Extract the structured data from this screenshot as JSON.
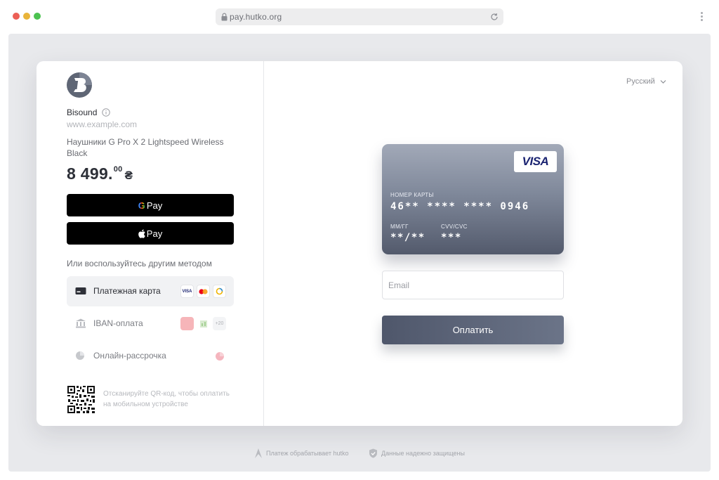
{
  "browser": {
    "url": "pay.hutko.org"
  },
  "merchant": {
    "name": "Bisound",
    "site": "www.example.com",
    "product": "Наушники G Pro X 2 Lightspeed Wireless Black",
    "price_main": "8 499.",
    "price_cents": "00",
    "currency": "₴"
  },
  "wallets": {
    "gpay_g": "G",
    "gpay_label": "Pay",
    "apay_label": "Pay"
  },
  "alt_methods_title": "Или воспользуйтесь другим методом",
  "methods": [
    {
      "label": "Платежная карта",
      "active": true,
      "badges": [
        "VISA",
        "mastercard",
        "card-ring"
      ]
    },
    {
      "label": "IBAN-оплата",
      "active": false,
      "badges": [
        "bank",
        "iban",
        "+20"
      ]
    },
    {
      "label": "Онлайн-рассрочка",
      "active": false,
      "badges": [
        "installment"
      ]
    }
  ],
  "iban_more": "+20",
  "visa_chip": "VISA",
  "qr_text": "Отсканируйте QR-код, чтобы оплатить на мобильном устройстве",
  "language": "Русский",
  "card": {
    "brand": "VISA",
    "number_label": "НОМЕР КАРТЫ",
    "number": "46** **** **** 0946",
    "expiry_label": "ММ/ГГ",
    "expiry": "**/**",
    "cvv_label": "CVV/CVC",
    "cvv": "***"
  },
  "form": {
    "email_placeholder": "Email",
    "submit_label": "Оплатить"
  },
  "footer": {
    "processed": "Платеж обрабатывает hutko",
    "secured": "Данные надежно защищены"
  },
  "colors": {
    "card_top": "#a2a9b8",
    "card_bottom": "#535a6c",
    "button": "#5b6478",
    "background": "#e8e9ec"
  }
}
